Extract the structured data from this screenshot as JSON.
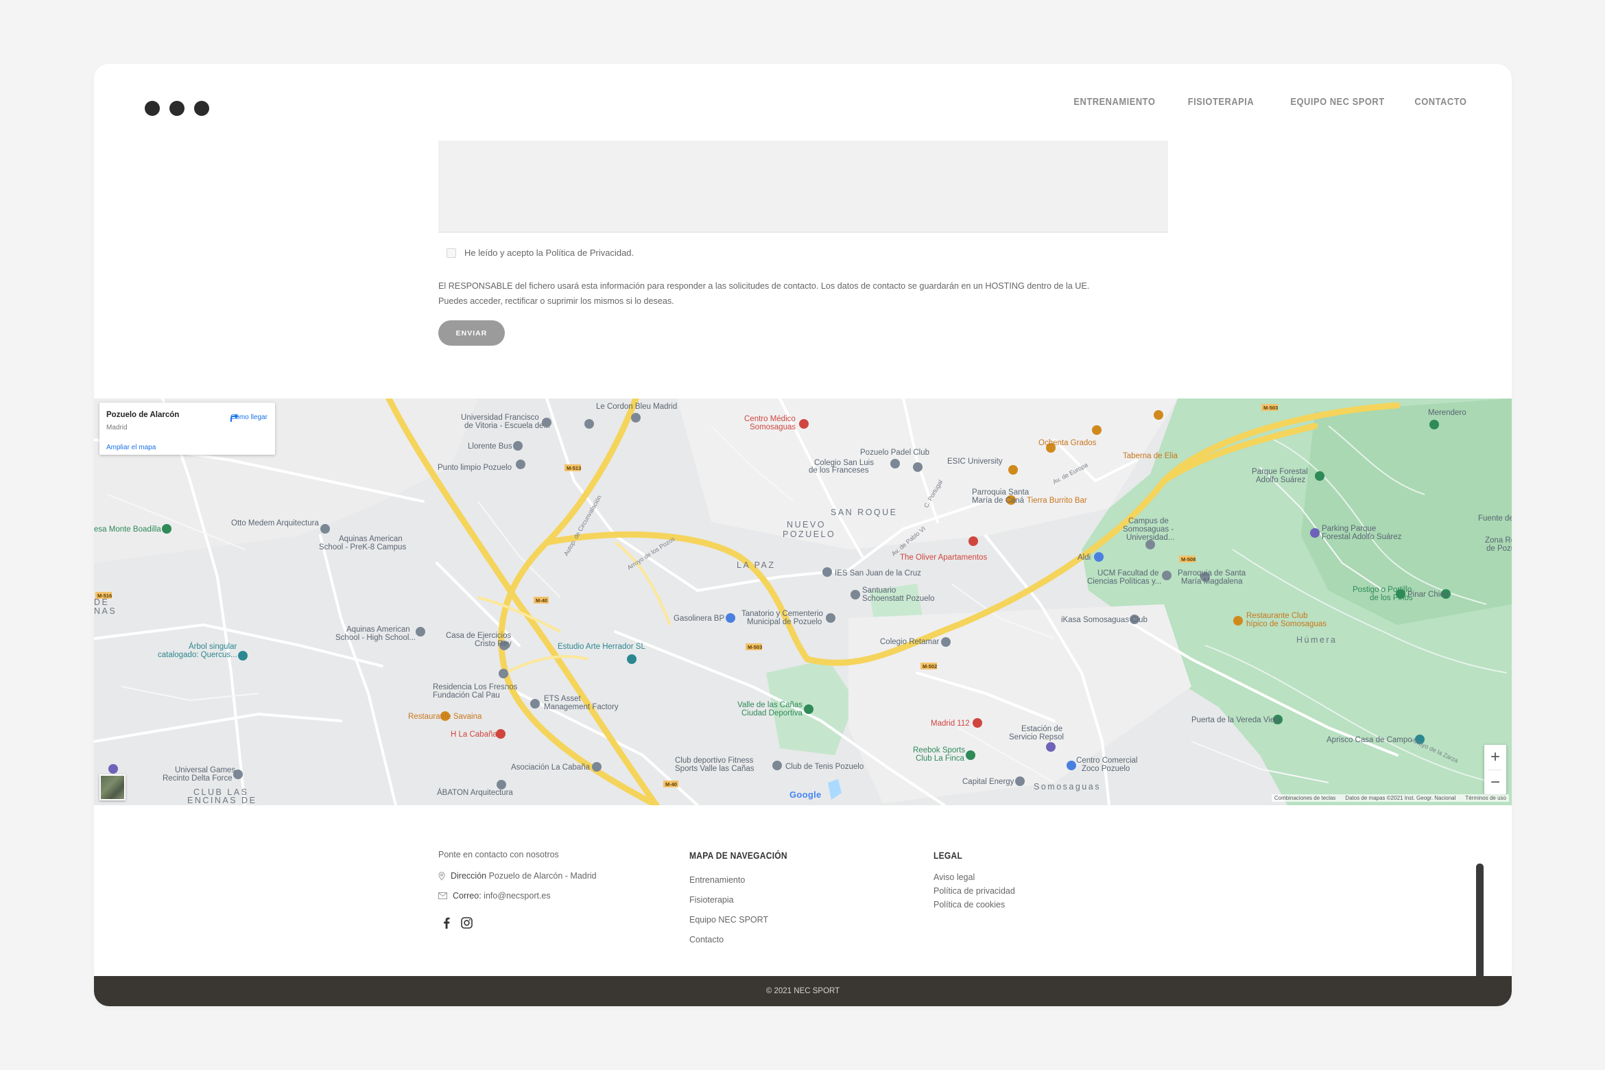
{
  "nav": [
    "ENTRENAMIENTO",
    "FISIOTERAPIA",
    "EQUIPO NEC SPORT",
    "CONTACTO"
  ],
  "form": {
    "consent_label": "He leído y acepto la Política de Privacidad.",
    "legal_line1": "El RESPONSABLE del fichero usará esta información para responder a las solicitudes de contacto. Los datos de contacto se guardarán en un HOSTING dentro de la UE.",
    "legal_line2": "Puedes acceder, rectificar o suprimir los mismos si lo deseas.",
    "send_label": "ENVIAR"
  },
  "map": {
    "place_title": "Pozuelo de Alarcón",
    "place_sub": "Madrid",
    "directions_label": "Cómo llegar",
    "enlarge_label": "Ampliar el mapa",
    "zoom_in": "+",
    "zoom_out": "−",
    "google": "Google",
    "attribution": [
      "Combinaciones de teclas",
      "Datos de mapas ©2021 Inst. Geogr. Nacional",
      "Términos de uso"
    ],
    "neighborhoods": [
      "SAN ROQUE",
      "NUEVO",
      "POZUELO",
      "LA PAZ",
      "CLUB LAS",
      "ENCINAS DE",
      "DE",
      "NAS",
      "Húmera",
      "Somosaguas"
    ],
    "pois": [
      "Universidad Francisco",
      "de Vitoria - Escuela de...",
      "Le Cordon Bleu Madrid",
      "Centro Médico",
      "Somosaguas",
      "Llorente Bus",
      "Punto limpio Pozuelo",
      "Pozuelo Padel Club",
      "Colegio San Luis",
      "de los Franceses",
      "ESIC University",
      "Ochenta Grados",
      "Taberna de Elia",
      "Parroquia Santa",
      "María de Caná",
      "Tierra Burrito Bar",
      "Parque Forestal",
      "Adolfo Suárez",
      "Merendero",
      "esa Monte Boadilla",
      "Otto Medem Arquitectura",
      "Aquinas American",
      "School - PreK-8 Campus",
      "The Oliver Apartamentos",
      "Campus de",
      "Somosaguas -",
      "Universidad...",
      "Parking Parque",
      "Forestal Adolfo Suárez",
      "Aldi",
      "Fuente de",
      "Zona Re",
      "de Pozu",
      "IES San Juan de la Cruz",
      "UCM Facultad de",
      "Ciencias Políticas y...",
      "Parroquia de Santa",
      "María Magdalena",
      "Postigo o Portillo",
      "de los Pinos",
      "Pinar Chico",
      "Santuario",
      "Schoenstatt Pozuelo",
      "Gasolinera BP",
      "Tanatorio y Cementerio",
      "Municipal de Pozuelo",
      "Aquinas American",
      "School - High School...",
      "Casa de Ejercicios",
      "Cristo Rey",
      "Árbol singular",
      "catalogado: Quercus...",
      "iKasa Somosaguas Club",
      "Restaurante Club",
      "hípico de Somosaguas",
      "Estudio Arte Herrador SL",
      "Colegio Retamar",
      "Residencia Los Fresnos",
      "Fundación Cal Pau",
      "ETS Asset",
      "Management Factory",
      "Restaurante Savaina",
      "H La Cabaña",
      "Valle de las Cañas",
      "Ciudad Deportiva",
      "Madrid 112",
      "Puerta de la Vereda Vieja",
      "Estación de",
      "Servicio Repsol",
      "Aprisco Casa de Campo",
      "Universal Games",
      "Recinto Delta Force",
      "Asociación La Cabaña",
      "Club deportivo Fitness",
      "Sports Valle las Cañas",
      "Club de Tenis Pozuelo",
      "Reebok Sports",
      "Club La Finca",
      "Centro Comercial",
      "Zoco Pozuelo",
      "Capital Energy",
      "ÁBATON Arquitectura"
    ],
    "roads": [
      "M-503",
      "M-513",
      "M-40",
      "M-502",
      "M-508",
      "M-516",
      "M-503",
      "M-40"
    ],
    "streets": [
      "Autop. de Circunvalación",
      "Arroyo de los Pozos",
      "Av. de Europa",
      "Arroyo de la Zarza",
      "C. Portugal",
      "Av. de Pablo VI"
    ]
  },
  "footer": {
    "contact_intro": "Ponte en contacto con nosotros",
    "address_label": "Dirección",
    "address_value": "Pozuelo de Alarcón - Madrid",
    "email_label": "Correo:",
    "email_value": "info@necsport.es",
    "nav_title": "MAPA DE NAVEGACIÓN",
    "nav_links": [
      "Entrenamiento",
      "Fisioterapia",
      "Equipo NEC SPORT",
      "Contacto"
    ],
    "legal_title": "LEGAL",
    "legal_links": [
      "Aviso legal",
      "Política de privacidad",
      "Política de cookies"
    ],
    "copyright": "© 2021 NEC SPORT"
  },
  "colors": {
    "page_bg": "#f4f4f4",
    "footer_bar": "#3a3632",
    "button": "#9b9b9b",
    "map_road_major": "#f7d96a",
    "map_park": "#a8dab5",
    "map_link": "#1a73e8"
  }
}
